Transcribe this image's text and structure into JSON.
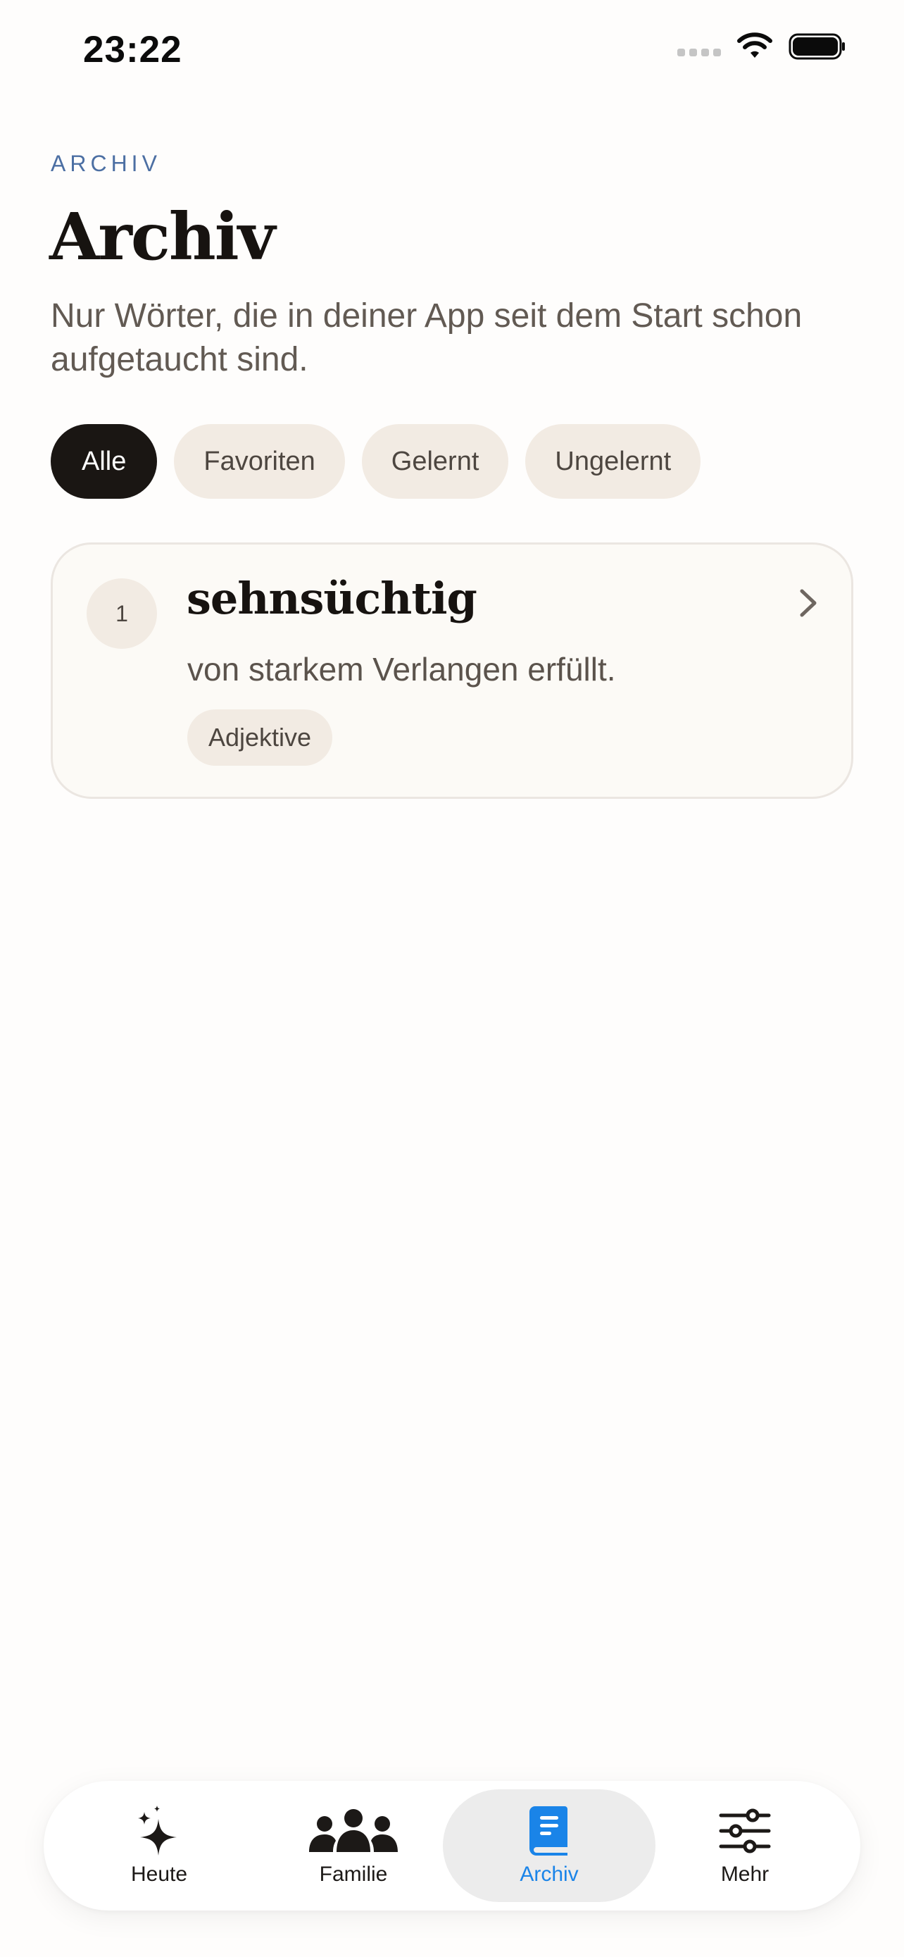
{
  "status_bar": {
    "time": "23:22",
    "icons": [
      "cellular-signal-icon",
      "wifi-icon",
      "battery-icon"
    ]
  },
  "header": {
    "eyebrow": "ARCHIV",
    "title": "Archiv",
    "subtitle": "Nur Wörter, die in deiner App seit dem Start schon aufgetaucht sind."
  },
  "filters": {
    "selected": "Alle",
    "items": [
      {
        "label": "Alle",
        "active": true
      },
      {
        "label": "Favoriten",
        "active": false
      },
      {
        "label": "Gelernt",
        "active": false
      },
      {
        "label": "Ungelernt",
        "active": false
      }
    ]
  },
  "words": [
    {
      "number": "1",
      "word": "sehnsüchtig",
      "definition": "von starkem Verlangen erfüllt.",
      "tag": "Adjektive"
    }
  ],
  "tabbar": {
    "items": [
      {
        "label": "Heute",
        "icon": "sparkles-icon",
        "active": false
      },
      {
        "label": "Familie",
        "icon": "people-icon",
        "active": false
      },
      {
        "label": "Archiv",
        "icon": "book-icon",
        "active": true
      },
      {
        "label": "Mehr",
        "icon": "sliders-icon",
        "active": false
      }
    ]
  },
  "colors": {
    "accent": "#1a84e8",
    "eyebrow": "#4c6fa3",
    "chip_active": "#1a1613",
    "chip": "#f2ebe3",
    "background": "#fefdfc"
  }
}
